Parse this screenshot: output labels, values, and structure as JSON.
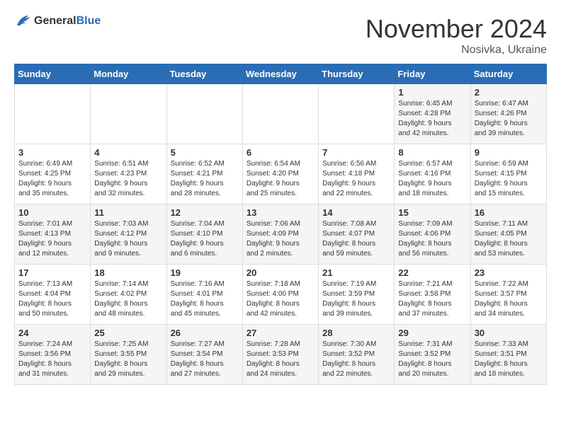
{
  "header": {
    "logo_general": "General",
    "logo_blue": "Blue",
    "title": "November 2024",
    "location": "Nosivka, Ukraine"
  },
  "columns": [
    "Sunday",
    "Monday",
    "Tuesday",
    "Wednesday",
    "Thursday",
    "Friday",
    "Saturday"
  ],
  "weeks": [
    {
      "days": [
        {
          "num": "",
          "info": ""
        },
        {
          "num": "",
          "info": ""
        },
        {
          "num": "",
          "info": ""
        },
        {
          "num": "",
          "info": ""
        },
        {
          "num": "",
          "info": ""
        },
        {
          "num": "1",
          "info": "Sunrise: 6:45 AM\nSunset: 4:28 PM\nDaylight: 9 hours\nand 42 minutes."
        },
        {
          "num": "2",
          "info": "Sunrise: 6:47 AM\nSunset: 4:26 PM\nDaylight: 9 hours\nand 39 minutes."
        }
      ]
    },
    {
      "days": [
        {
          "num": "3",
          "info": "Sunrise: 6:49 AM\nSunset: 4:25 PM\nDaylight: 9 hours\nand 35 minutes."
        },
        {
          "num": "4",
          "info": "Sunrise: 6:51 AM\nSunset: 4:23 PM\nDaylight: 9 hours\nand 32 minutes."
        },
        {
          "num": "5",
          "info": "Sunrise: 6:52 AM\nSunset: 4:21 PM\nDaylight: 9 hours\nand 28 minutes."
        },
        {
          "num": "6",
          "info": "Sunrise: 6:54 AM\nSunset: 4:20 PM\nDaylight: 9 hours\nand 25 minutes."
        },
        {
          "num": "7",
          "info": "Sunrise: 6:56 AM\nSunset: 4:18 PM\nDaylight: 9 hours\nand 22 minutes."
        },
        {
          "num": "8",
          "info": "Sunrise: 6:57 AM\nSunset: 4:16 PM\nDaylight: 9 hours\nand 18 minutes."
        },
        {
          "num": "9",
          "info": "Sunrise: 6:59 AM\nSunset: 4:15 PM\nDaylight: 9 hours\nand 15 minutes."
        }
      ]
    },
    {
      "days": [
        {
          "num": "10",
          "info": "Sunrise: 7:01 AM\nSunset: 4:13 PM\nDaylight: 9 hours\nand 12 minutes."
        },
        {
          "num": "11",
          "info": "Sunrise: 7:03 AM\nSunset: 4:12 PM\nDaylight: 9 hours\nand 9 minutes."
        },
        {
          "num": "12",
          "info": "Sunrise: 7:04 AM\nSunset: 4:10 PM\nDaylight: 9 hours\nand 6 minutes."
        },
        {
          "num": "13",
          "info": "Sunrise: 7:06 AM\nSunset: 4:09 PM\nDaylight: 9 hours\nand 2 minutes."
        },
        {
          "num": "14",
          "info": "Sunrise: 7:08 AM\nSunset: 4:07 PM\nDaylight: 8 hours\nand 59 minutes."
        },
        {
          "num": "15",
          "info": "Sunrise: 7:09 AM\nSunset: 4:06 PM\nDaylight: 8 hours\nand 56 minutes."
        },
        {
          "num": "16",
          "info": "Sunrise: 7:11 AM\nSunset: 4:05 PM\nDaylight: 8 hours\nand 53 minutes."
        }
      ]
    },
    {
      "days": [
        {
          "num": "17",
          "info": "Sunrise: 7:13 AM\nSunset: 4:04 PM\nDaylight: 8 hours\nand 50 minutes."
        },
        {
          "num": "18",
          "info": "Sunrise: 7:14 AM\nSunset: 4:02 PM\nDaylight: 8 hours\nand 48 minutes."
        },
        {
          "num": "19",
          "info": "Sunrise: 7:16 AM\nSunset: 4:01 PM\nDaylight: 8 hours\nand 45 minutes."
        },
        {
          "num": "20",
          "info": "Sunrise: 7:18 AM\nSunset: 4:00 PM\nDaylight: 8 hours\nand 42 minutes."
        },
        {
          "num": "21",
          "info": "Sunrise: 7:19 AM\nSunset: 3:59 PM\nDaylight: 8 hours\nand 39 minutes."
        },
        {
          "num": "22",
          "info": "Sunrise: 7:21 AM\nSunset: 3:58 PM\nDaylight: 8 hours\nand 37 minutes."
        },
        {
          "num": "23",
          "info": "Sunrise: 7:22 AM\nSunset: 3:57 PM\nDaylight: 8 hours\nand 34 minutes."
        }
      ]
    },
    {
      "days": [
        {
          "num": "24",
          "info": "Sunrise: 7:24 AM\nSunset: 3:56 PM\nDaylight: 8 hours\nand 31 minutes."
        },
        {
          "num": "25",
          "info": "Sunrise: 7:25 AM\nSunset: 3:55 PM\nDaylight: 8 hours\nand 29 minutes."
        },
        {
          "num": "26",
          "info": "Sunrise: 7:27 AM\nSunset: 3:54 PM\nDaylight: 8 hours\nand 27 minutes."
        },
        {
          "num": "27",
          "info": "Sunrise: 7:28 AM\nSunset: 3:53 PM\nDaylight: 8 hours\nand 24 minutes."
        },
        {
          "num": "28",
          "info": "Sunrise: 7:30 AM\nSunset: 3:52 PM\nDaylight: 8 hours\nand 22 minutes."
        },
        {
          "num": "29",
          "info": "Sunrise: 7:31 AM\nSunset: 3:52 PM\nDaylight: 8 hours\nand 20 minutes."
        },
        {
          "num": "30",
          "info": "Sunrise: 7:33 AM\nSunset: 3:51 PM\nDaylight: 8 hours\nand 18 minutes."
        }
      ]
    }
  ]
}
